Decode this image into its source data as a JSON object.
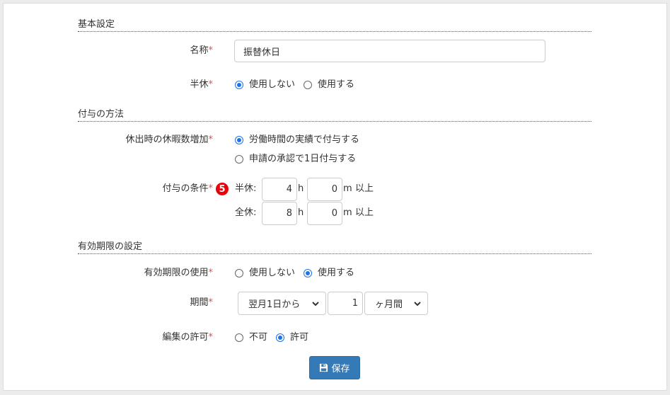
{
  "sections": {
    "basic": "基本設定",
    "method": "付与の方法",
    "expiry": "有効期限の設定"
  },
  "required_mark": "*",
  "name_field": {
    "label": "名称",
    "value": "振替休日"
  },
  "half_day": {
    "label": "半休",
    "options": [
      "使用しない",
      "使用する"
    ],
    "selected": "使用しない"
  },
  "holiday_increase": {
    "label": "休出時の休暇数増加",
    "options": [
      "労働時間の実績で付与する",
      "申請の承認で1日付与する"
    ],
    "selected": "労働時間の実績で付与する"
  },
  "grant_condition": {
    "label": "付与の条件",
    "badge": "5",
    "half": {
      "label": "半休:",
      "hours": "4",
      "minutes": "0"
    },
    "full": {
      "label": "全休:",
      "hours": "8",
      "minutes": "0"
    },
    "hour_unit": "h",
    "minute_unit": "m",
    "suffix": "以上"
  },
  "expiry_use": {
    "label": "有効期限の使用",
    "options": [
      "使用しない",
      "使用する"
    ],
    "selected": "使用する"
  },
  "period": {
    "label": "期間",
    "start_select": "翌月1日から",
    "amount": "1",
    "unit_select": "ヶ月間"
  },
  "edit_permission": {
    "label": "編集の許可",
    "options": [
      "不可",
      "許可"
    ],
    "selected": "許可"
  },
  "save_button": {
    "label": "保存",
    "icon": "floppy-disk-icon"
  },
  "colors": {
    "required": "#d9534f",
    "radio_selected": "#1a73e8",
    "badge": "#e8000b",
    "primary_button": "#337ab7"
  }
}
